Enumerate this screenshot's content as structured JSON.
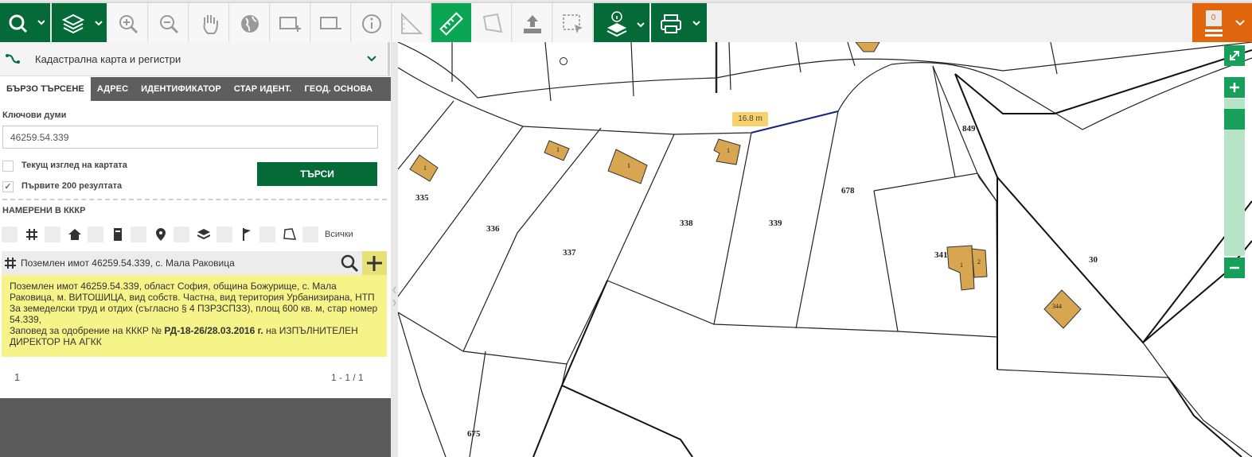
{
  "toolbar": {
    "items": [
      "search-menu",
      "layers-menu",
      "zoom-in",
      "zoom-out",
      "pan",
      "full-extent",
      "zoom-rect-in",
      "zoom-rect-out",
      "identify",
      "measure-settings",
      "measure-distance",
      "measure-area",
      "upload",
      "select-area",
      "feature-info",
      "print"
    ],
    "user_badge_count": "0"
  },
  "panel": {
    "header_title": "Кадастрална карта и регистри",
    "tabs": [
      "БЪРЗО ТЪРСЕНЕ",
      "АДРЕС",
      "ИДЕНТИФИКАТОР",
      "СТАР ИДЕНТ.",
      "ГЕОД. ОСНОВА"
    ],
    "keywords_label": "Ключови думи",
    "keywords_value": "46259.54.339",
    "current_view_label": "Текущ изглед на картата",
    "first200_label": "Първите 200 резултата",
    "first200_checkmark": "✓",
    "search_button": "ТЪРСИ",
    "found_label": "НАМЕРЕНИ В КККР",
    "filter_all": "Всички",
    "result_title": "Поземлен имот 46259.54.339, с. Мала Раковица",
    "result_text": "Поземлен имот 46259.54.339, област София, община Божурище, с. Мала Раковица, м. ВИТОШИЦА, вид собств. Частна, вид територия Урбанизирана, НТП За земеделски труд и отдих (съгласно § 4 ПЗРЗСПЗЗ), площ 600 кв. м, стар номер 54.339,",
    "order_prefix": "Заповед за одобрение на КККР № ",
    "order_number": "РД-18-26/28.03.2016 г.",
    "order_suffix": " на ИЗПЪЛНИТЕЛЕН ДИРЕКТОР НА АГКК",
    "page_number": "1",
    "page_range": "1 - 1 / 1"
  },
  "map": {
    "measure_label": "16.8 m",
    "parcels": [
      "335",
      "336",
      "337",
      "338",
      "339",
      "678",
      "849",
      "341",
      "30",
      "675"
    ],
    "building_labels": [
      "1",
      "1",
      "1",
      "1",
      "1",
      "2",
      "344"
    ],
    "colors": {
      "building": "#d8a650",
      "measure_line": "#1a237e",
      "parcel_line": "#222222"
    }
  }
}
